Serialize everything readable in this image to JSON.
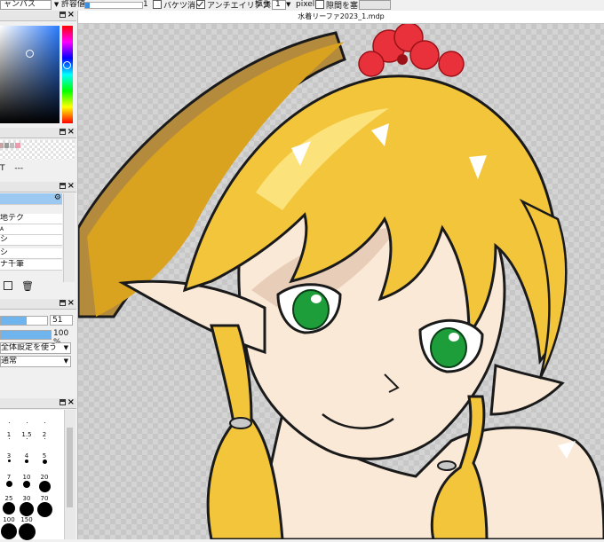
{
  "toolbar": {
    "canvas_select": "ャンバス",
    "tolerance_label": "許容値",
    "tolerance_value": "1",
    "bucket_erase": "バケツ消し",
    "antialias": "アンチエイリアス",
    "expand_label": "拡張",
    "expand_value": "1",
    "expand_unit": "pixel",
    "close_gap": "隙間を塞ぐ"
  },
  "document": {
    "title": "水着リーファ2023_1.mdp"
  },
  "layers": {
    "items": [
      "",
      "地テク",
      "A",
      "シ",
      "シ",
      "ナ千筆"
    ]
  },
  "params": {
    "size_value": "51",
    "opacity_value": "100 %",
    "mode_select": "全体設定を使う",
    "blend_select": "通常",
    "opacity_level": 1.0,
    "size_level": 0.55
  },
  "color_value": "---",
  "brushes": {
    "labels": [
      "1",
      "1.5",
      "2",
      "3",
      "4",
      "5",
      "7",
      "10",
      "20",
      "25",
      "30",
      "70",
      "100",
      "150"
    ]
  },
  "colors": {
    "accent": "#6fb4ec",
    "panel": "#f0f0f0",
    "hair": "#f2c53b",
    "hair_shadow": "#d9a31f",
    "skin": "#fbe9d7",
    "eye": "#1e9e3b",
    "flower": "#e8313b",
    "outline": "#1a1a1a"
  }
}
